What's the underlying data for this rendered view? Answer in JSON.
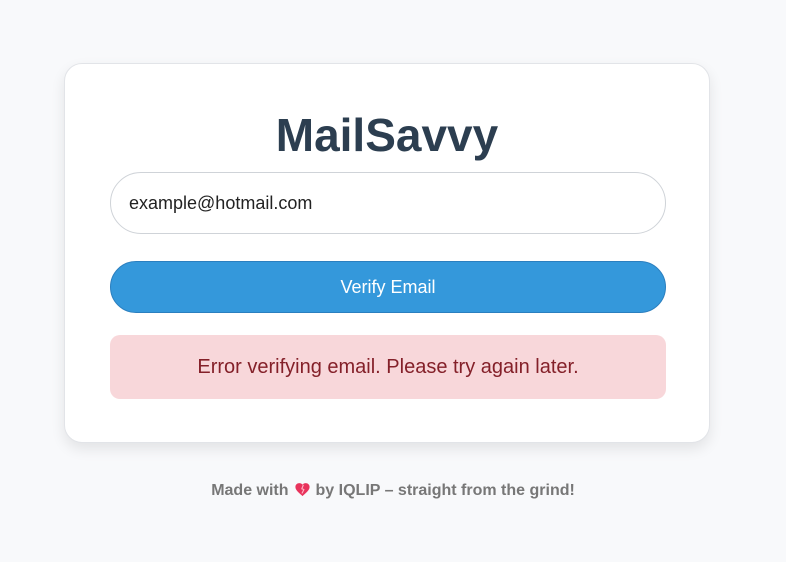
{
  "app": {
    "title": "MailSavvy"
  },
  "form": {
    "email_value": "example@hotmail.com",
    "verify_button_label": "Verify Email"
  },
  "status": {
    "error_message": "Error verifying email. Please try again later."
  },
  "footer": {
    "prefix": "Made with",
    "icon": "heart-icon",
    "suffix": "by IQLIP – straight from the grind!"
  },
  "colors": {
    "title": "#2c3e50",
    "button": "#3498db",
    "error_background": "#f8d7da",
    "error_text": "#842029",
    "heart": "#e8345c"
  }
}
